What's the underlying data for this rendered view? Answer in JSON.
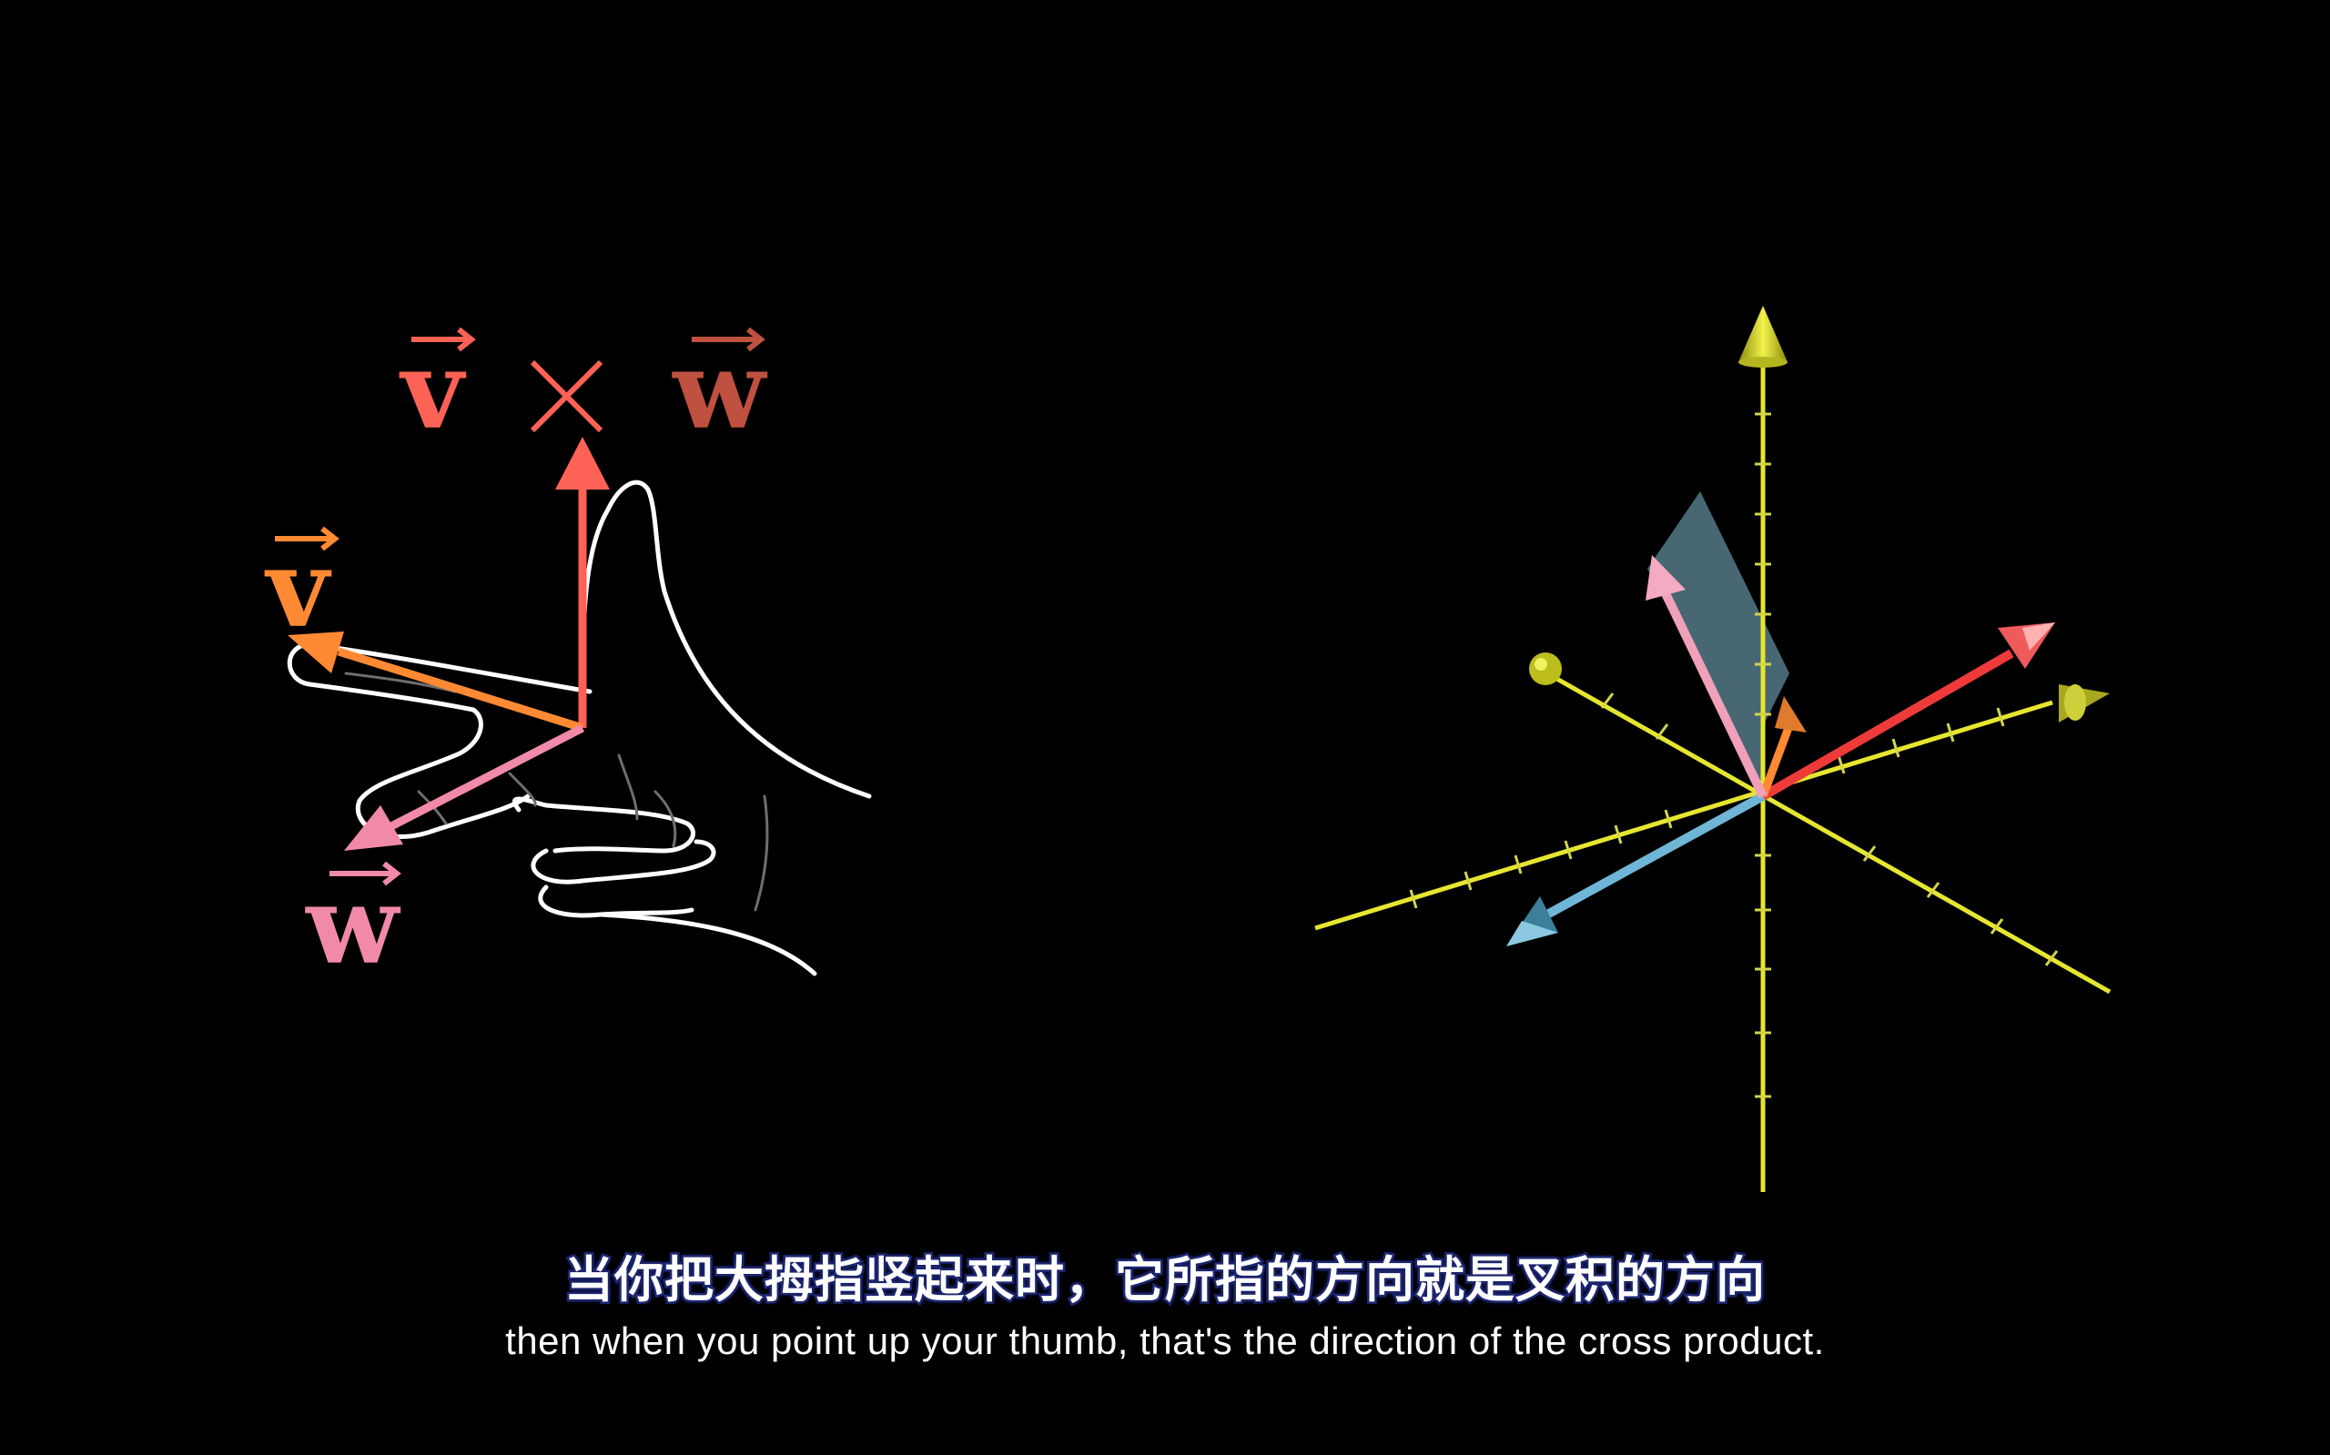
{
  "colors": {
    "background": "#000000",
    "v_vector": "#ff8a33",
    "w_vector": "#f08aa8",
    "cross_vector": "#fc6255",
    "w_label_dark": "#c0503f",
    "axis": "#e6e630",
    "hand_outline": "#ffffff",
    "cyan_vector": "#6fb6d6",
    "red_vector_3d": "#ef3a3a",
    "parallelogram": "#5f8a9a"
  },
  "equation": {
    "v": "v",
    "times": "×",
    "w": "w"
  },
  "hand_labels": {
    "v": "v",
    "w": "w"
  },
  "subtitles": {
    "chinese": "当你把大拇指竖起来时，它所指的方向就是叉积的方向",
    "english": "then when you point up your thumb, that's the direction of the cross product."
  }
}
